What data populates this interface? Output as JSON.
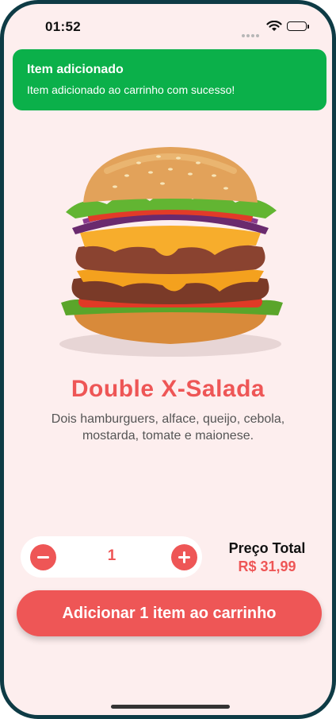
{
  "status_bar": {
    "time": "01:52"
  },
  "toast": {
    "title": "Item adicionado",
    "message": "Item adicionado ao carrinho com sucesso!"
  },
  "product": {
    "image_icon": "burger-image",
    "name": "Double X-Salada",
    "description": "Dois hamburguers, alface, queijo, cebola, mostarda, tomate e maionese."
  },
  "quantity": {
    "value": "1",
    "decrement_icon": "minus-icon",
    "increment_icon": "plus-icon"
  },
  "price": {
    "label": "Preço Total",
    "value": "R$ 31,99"
  },
  "actions": {
    "add_to_cart": "Adicionar 1 item ao carrinho"
  },
  "colors": {
    "accent": "#ee5656",
    "success": "#0bb04a",
    "background": "#fdeeee"
  }
}
